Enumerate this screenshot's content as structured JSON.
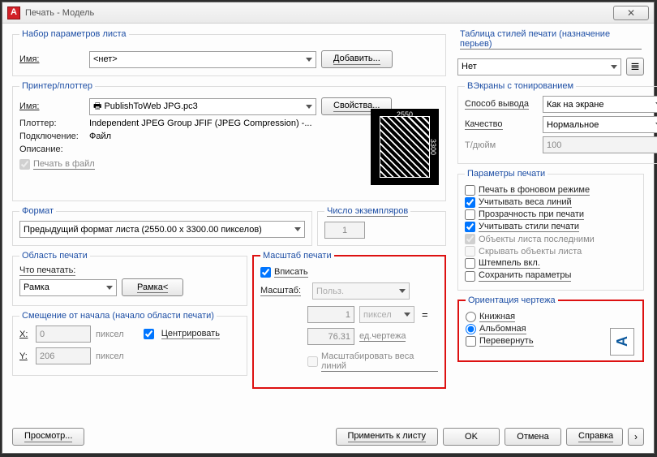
{
  "window": {
    "title": "Печать - Модель",
    "app_letter": "A",
    "close_x": "✕"
  },
  "pageSetup": {
    "legend": "Набор параметров листа",
    "name_label": "Имя:",
    "name_value": "<нет>",
    "add_btn": "Добавить..."
  },
  "printer": {
    "legend": "Принтер/плоттер",
    "name_label": "Имя:",
    "device": "PublishToWeb JPG.pc3",
    "props_btn": "Свойства...",
    "plotter_label": "Плоттер:",
    "plotter_value": "Independent JPEG Group JFIF (JPEG Compression) -...",
    "conn_label": "Подключение:",
    "conn_value": "Файл",
    "desc_label": "Описание:",
    "print_to_file": "Печать в файл",
    "preview_top": "2550",
    "preview_side": "3300"
  },
  "paper": {
    "legend": "Формат",
    "value": "Предыдущий формат листа  (2550.00 x 3300.00 пикселов)",
    "copies_legend": "Число экземпляров",
    "copies_value": "1"
  },
  "area": {
    "legend": "Область печати",
    "what_label": "Что печатать:",
    "what_value": "Рамка",
    "frame_btn": "Рамка<"
  },
  "offset": {
    "legend": "Смещение от начала (начало области печати)",
    "x_label": "X:",
    "x_value": "0",
    "x_unit": "пиксел",
    "y_label": "Y:",
    "y_value": "206",
    "y_unit": "пиксел",
    "center": "Центрировать"
  },
  "scale": {
    "legend": "Масштаб печати",
    "fit": "Вписать",
    "scale_label": "Масштаб:",
    "scale_value": "Польз.",
    "unit_num": "1",
    "unit_name": "пиксел",
    "eq": "=",
    "drawing_units": "76.31",
    "drawing_units_label": "ед.чертежа",
    "scale_lw": "Масштабировать веса линий"
  },
  "styles": {
    "legend": "Таблица стилей печати (назначение перьев)",
    "value": "Нет",
    "icon": "𝌆"
  },
  "shaded": {
    "legend": "ВЭкраны с тонированием",
    "method_label": "Способ вывода",
    "method_value": "Как на экране",
    "quality_label": "Качество",
    "quality_value": "Нормальное",
    "dpi_label": "Т/дюйм",
    "dpi_value": "100"
  },
  "options": {
    "legend": "Параметры печати",
    "bg": "Печать в фоновом режиме",
    "lw": "Учитывать веса линий",
    "transp": "Прозрачность при печати",
    "styles_on": "Учитывать стили печати",
    "last": "Объекты листа последними",
    "hide": "Скрывать объекты листа",
    "stamp": "Штемпель вкл.",
    "save": "Сохранить параметры"
  },
  "orient": {
    "legend": "Ориентация чертежа",
    "portrait": "Книжная",
    "landscape": "Альбомная",
    "upside": "Перевернуть",
    "letter": "A"
  },
  "buttons": {
    "preview": "Просмотр...",
    "apply": "Применить к листу",
    "ok": "OK",
    "cancel": "Отмена",
    "help": "Справка",
    "expand": "›"
  }
}
